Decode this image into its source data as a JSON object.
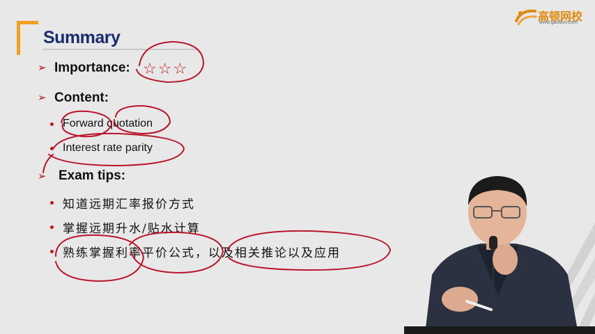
{
  "header": {
    "title": "Summary",
    "logo_cn": "高顿网校",
    "logo_url": "www.gaodun.com"
  },
  "importance": {
    "label": "Importance:",
    "stars": "☆☆☆",
    "star_count": 3
  },
  "content": {
    "label": "Content:",
    "items": [
      "Forward quotation",
      "Interest rate parity"
    ]
  },
  "exam_tips": {
    "label": "Exam tips:",
    "items": [
      "知道远期汇率报价方式",
      "掌握远期升水/贴水计算",
      "熟练掌握利率平价公式，以及相关推论以及应用"
    ]
  },
  "colors": {
    "title": "#1a2d6e",
    "accent": "#f0a020",
    "bullet": "#c01818",
    "ink": "#b8142a",
    "background": "#e8e8e8"
  },
  "icons": [
    "arrow-bullet-icon",
    "dot-bullet-icon",
    "star-icon",
    "gaodun-logo-icon"
  ]
}
